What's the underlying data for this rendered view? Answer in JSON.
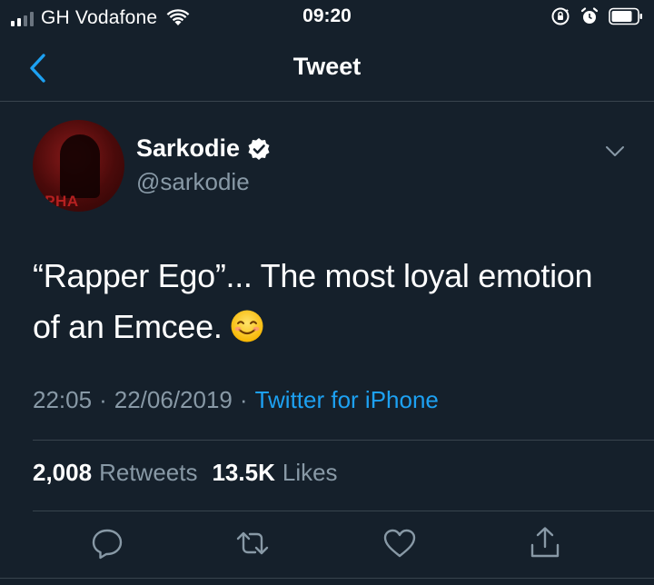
{
  "status_bar": {
    "carrier": "GH Vodafone",
    "time": "09:20"
  },
  "nav": {
    "title": "Tweet"
  },
  "author": {
    "display_name": "Sarkodie",
    "handle": "@sarkodie",
    "avatar_text": "IPHA"
  },
  "tweet": {
    "text": "“Rapper Ego”... The most loyal emotion of an Emcee.",
    "time": "22:05",
    "separator": "·",
    "date": "22/06/2019",
    "source": "Twitter for iPhone"
  },
  "stats": {
    "retweets_count": "2,008",
    "retweets_label": "Retweets",
    "likes_count": "13.5K",
    "likes_label": "Likes"
  },
  "colors": {
    "background": "#15202b",
    "accent": "#1da1f2",
    "secondary_text": "#8899a6",
    "divider": "#38444d"
  },
  "icons": {
    "back": "chevron-left-icon",
    "verified": "verified-badge-icon",
    "more": "chevron-down-icon",
    "reply": "reply-icon",
    "retweet": "retweet-icon",
    "like": "heart-icon",
    "share": "share-icon",
    "emoji": "smiling-face-emoji"
  }
}
